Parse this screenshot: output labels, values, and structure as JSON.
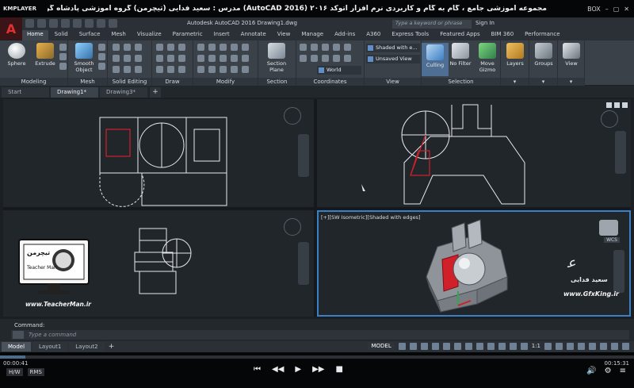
{
  "player": {
    "logo": "KMPLAYER",
    "title": "مجموعه آموزشی جامع ، گام به گام و کاربردی نرم افزار اتوکد ۲۰۱۶ (AutoCAD 2016) مدرس : سعید فدایی (تیچرمن) گروه آموزشی پادشاه گرافیست ها",
    "top_right": [
      "BOX",
      "–",
      "▢",
      "✕"
    ],
    "time_elapsed": "00:00:41",
    "time_total": "00:15:31",
    "progress": 0.04,
    "left_buttons": [
      "H/W",
      "RMS"
    ],
    "controls": [
      "⏮",
      "◀◀",
      "▶",
      "▶▶",
      "■"
    ],
    "right_icons": [
      "🔊",
      "⚙",
      "≡"
    ]
  },
  "app": {
    "logo": "A",
    "title": "Autodesk AutoCAD 2016     Drawing1.dwg",
    "search_placeholder": "Type a keyword or phrase",
    "sign_in": "Sign In"
  },
  "ribbon_tabs": [
    "Home",
    "Solid",
    "Surface",
    "Mesh",
    "Visualize",
    "Parametric",
    "Insert",
    "Annotate",
    "View",
    "Manage",
    "Add-ins",
    "A360",
    "Express Tools",
    "Featured Apps",
    "BIM 360",
    "Performance"
  ],
  "ribbon_groups": {
    "modeling": {
      "label": "Modeling",
      "tools": [
        "Sphere",
        "Extrude"
      ]
    },
    "mesh": {
      "label": "Mesh",
      "tools": [
        "Smooth Object"
      ]
    },
    "solid_editing": {
      "label": "Solid Editing"
    },
    "draw": {
      "label": "Draw"
    },
    "modify": {
      "label": "Modify"
    },
    "section": {
      "label": "Section",
      "tools": [
        "Section Plane"
      ]
    },
    "coordinates": {
      "label": "Coordinates",
      "ucs": "World"
    },
    "view": {
      "label": "View",
      "visual_style": "Shaded with e...",
      "saved_view": "Unsaved View"
    },
    "selection": {
      "label": "Selection",
      "tools": [
        "Culling",
        "No Filter",
        "Move Gizmo"
      ]
    },
    "layers": {
      "label": "Layers"
    },
    "groups": {
      "label": "Groups"
    },
    "view2": {
      "label": "View"
    }
  },
  "file_tabs": [
    "Start",
    "Drawing1*",
    "Drawing3*"
  ],
  "viewports": {
    "active_label": "[+][SW Isometric][Shaded with edges]",
    "wcs_label": "WCS"
  },
  "watermarks": {
    "teacher_logo_text": [
      "تیچرمن",
      "Teacher Man"
    ],
    "teacher_url": "www.TeacherMan.ir",
    "signature": "سعید فدایی",
    "gfx_url": "www.GfxKing.ir"
  },
  "command": {
    "label": "Command:",
    "placeholder": "Type a command"
  },
  "layout_tabs": [
    "Model",
    "Layout1",
    "Layout2"
  ],
  "status": {
    "model_label": "MODEL",
    "scale": "1:1"
  },
  "colors": {
    "viewport_bg": "#21262b",
    "active_border": "#3b7fc4",
    "ribbon_bg": "#3a4148",
    "solid_gray": "#9aa0a6",
    "accent_red": "#d0202a"
  }
}
